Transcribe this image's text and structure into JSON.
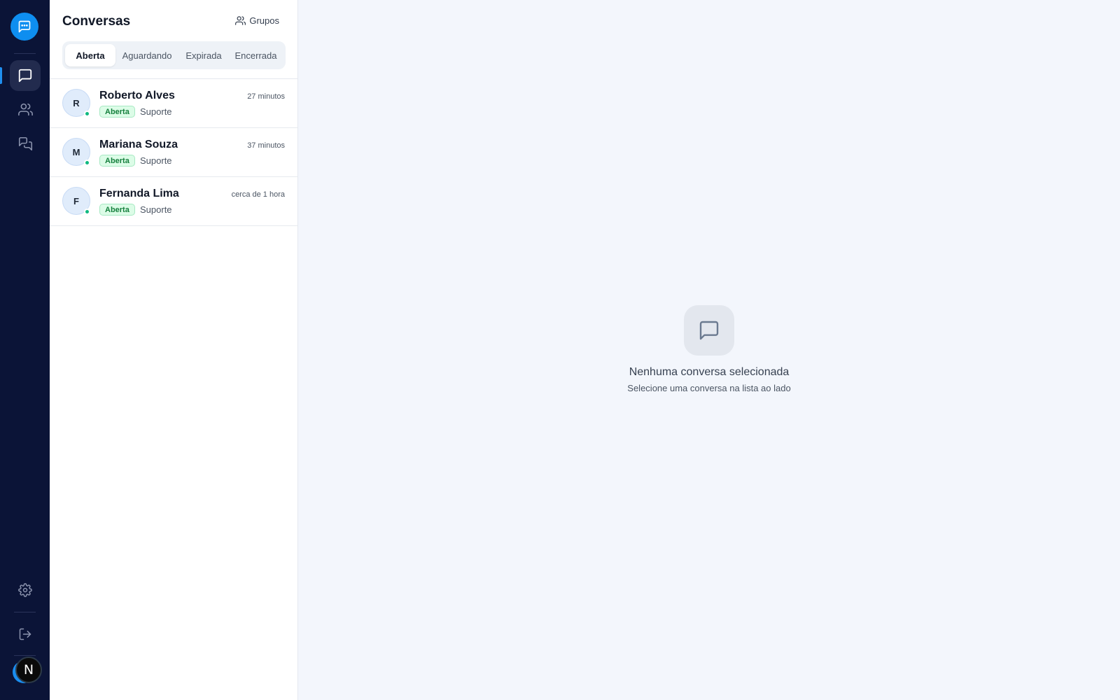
{
  "rail": {
    "logo_icon": "chat-bubble-dots-icon",
    "nav": [
      {
        "icon": "message-square-icon",
        "active": true
      },
      {
        "icon": "users-icon",
        "active": false
      },
      {
        "icon": "messages-icon",
        "active": false
      }
    ],
    "bottom": [
      {
        "icon": "gear-icon"
      },
      {
        "icon": "logout-icon"
      }
    ],
    "user_initial": "N"
  },
  "panel": {
    "title": "Conversas",
    "groups_label": "Grupos",
    "tabs": [
      {
        "label": "Aberta",
        "active": true
      },
      {
        "label": "Aguardando",
        "active": false
      },
      {
        "label": "Expirada",
        "active": false
      },
      {
        "label": "Encerrada",
        "active": false
      }
    ],
    "conversations": [
      {
        "initial": "R",
        "name": "Roberto Alves",
        "time": "27 minutos",
        "status": "Aberta",
        "queue": "Suporte",
        "online": true
      },
      {
        "initial": "M",
        "name": "Mariana Souza",
        "time": "37 minutos",
        "status": "Aberta",
        "queue": "Suporte",
        "online": true
      },
      {
        "initial": "F",
        "name": "Fernanda Lima",
        "time": "cerca de 1 hora",
        "status": "Aberta",
        "queue": "Suporte",
        "online": true
      }
    ]
  },
  "empty_state": {
    "icon": "message-square-icon",
    "title": "Nenhuma conversa selecionada",
    "subtitle": "Selecione uma conversa na lista ao lado"
  },
  "colors": {
    "rail_bg": "#0b1437",
    "accent": "#0e8ef0",
    "online": "#10b981",
    "badge_bg": "#dcfce7",
    "badge_text": "#15803d"
  }
}
